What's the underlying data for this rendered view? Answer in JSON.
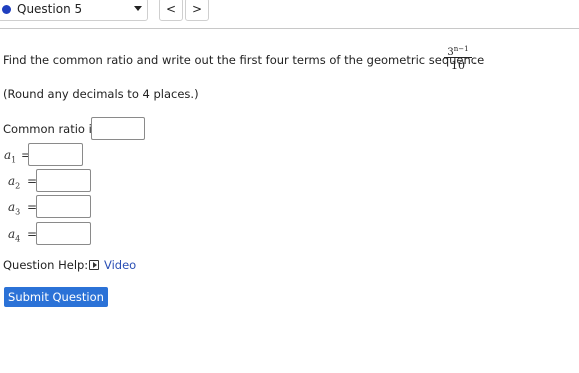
{
  "header": {
    "question_label": "Question 5",
    "prev_symbol": "<",
    "next_symbol": ">"
  },
  "problem": {
    "prompt": "Find the common ratio and write out the first four terms of the geometric sequence",
    "formula_base": "3",
    "formula_exponent": "n−1",
    "formula_denominator": "10",
    "end_punct": ".",
    "rounding_note": "(Round any decimals to 4 places.)"
  },
  "ratio": {
    "label": "Common ratio is",
    "value": ""
  },
  "terms": [
    {
      "var": "a",
      "sub": "1",
      "eq": "=",
      "value": ""
    },
    {
      "var": "a",
      "sub": "2",
      "eq": "=",
      "value": ""
    },
    {
      "var": "a",
      "sub": "3",
      "eq": "=",
      "value": ""
    },
    {
      "var": "a",
      "sub": "4",
      "eq": "=",
      "value": ""
    }
  ],
  "help": {
    "label": "Question Help:",
    "video_label": "Video"
  },
  "submit_label": "Submit Question",
  "colors": {
    "accent": "#2b72d7",
    "link": "#2a4fb5",
    "status_dot": "#1f3fbf"
  }
}
